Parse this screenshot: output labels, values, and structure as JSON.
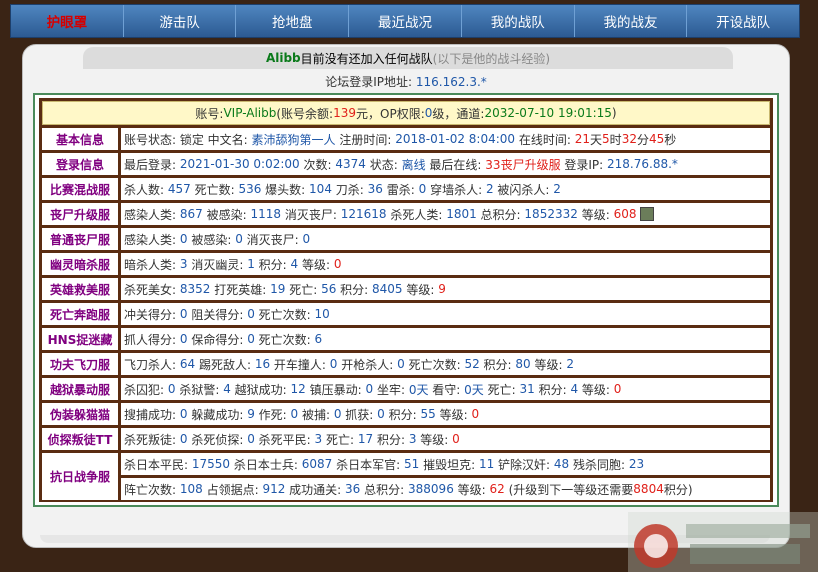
{
  "nav": [
    "护眼罩",
    "游击队",
    "抢地盘",
    "最近战况",
    "我的战队",
    "我的战友",
    "开设战队"
  ],
  "tabhead": {
    "name": "Alibb",
    "text": "目前没有还加入任何战队",
    "hint": "(以下是他的战斗经验)"
  },
  "ip": {
    "label": "论坛登录IP地址:",
    "value": "116.162.3.*"
  },
  "account": [
    {
      "t": "账号:",
      "c": "k"
    },
    {
      "t": "VIP-Alibb",
      "c": "g"
    },
    {
      "t": "(账号余额:",
      "c": "k"
    },
    {
      "t": "139",
      "c": "r"
    },
    {
      "t": "元，OP权限:",
      "c": "k"
    },
    {
      "t": "0",
      "c": "b"
    },
    {
      "t": "级，通道:",
      "c": "k"
    },
    {
      "t": "2032-07-10 19:01:15",
      "c": "g"
    },
    {
      "t": ")",
      "c": "k"
    }
  ],
  "rows": [
    {
      "label": "基本信息",
      "lines": [
        [
          {
            "t": "账号状态: 锁定 中文名: ",
            "c": "k"
          },
          {
            "t": "素沛舔狗第一人",
            "c": "b"
          },
          {
            "t": " 注册时间: ",
            "c": "k"
          },
          {
            "t": "2018-01-02 8:04:00",
            "c": "b"
          },
          {
            "t": " 在线时间: ",
            "c": "k"
          },
          {
            "t": "21",
            "c": "r"
          },
          {
            "t": "天",
            "c": "k"
          },
          {
            "t": "5",
            "c": "r"
          },
          {
            "t": "时",
            "c": "k"
          },
          {
            "t": "32",
            "c": "r"
          },
          {
            "t": "分",
            "c": "k"
          },
          {
            "t": "45",
            "c": "r"
          },
          {
            "t": "秒",
            "c": "k"
          }
        ]
      ]
    },
    {
      "label": "登录信息",
      "lines": [
        [
          {
            "t": "最后登录: ",
            "c": "k"
          },
          {
            "t": "2021-01-30 0:02:00",
            "c": "b"
          },
          {
            "t": " 次数: ",
            "c": "k"
          },
          {
            "t": "4374",
            "c": "b"
          },
          {
            "t": " 状态: ",
            "c": "k"
          },
          {
            "t": "离线",
            "c": "b"
          },
          {
            "t": " 最后在线: ",
            "c": "k"
          },
          {
            "t": "33丧尸升级服",
            "c": "r"
          },
          {
            "t": " 登录IP: ",
            "c": "k"
          },
          {
            "t": "218.76.88.*",
            "c": "b"
          }
        ]
      ]
    },
    {
      "label": "比赛混战服",
      "lines": [
        [
          {
            "t": "杀人数: ",
            "c": "k"
          },
          {
            "t": "457",
            "c": "b"
          },
          {
            "t": " 死亡数: ",
            "c": "k"
          },
          {
            "t": "536",
            "c": "b"
          },
          {
            "t": " 爆头数: ",
            "c": "k"
          },
          {
            "t": "104",
            "c": "b"
          },
          {
            "t": " 刀杀: ",
            "c": "k"
          },
          {
            "t": "36",
            "c": "b"
          },
          {
            "t": " 雷杀: ",
            "c": "k"
          },
          {
            "t": "0",
            "c": "b"
          },
          {
            "t": " 穿墙杀人: ",
            "c": "k"
          },
          {
            "t": "2",
            "c": "b"
          },
          {
            "t": " 被闪杀人: ",
            "c": "k"
          },
          {
            "t": "2",
            "c": "b"
          }
        ]
      ]
    },
    {
      "label": "丧尸升级服",
      "avatar": true,
      "lines": [
        [
          {
            "t": "感染人类: ",
            "c": "k"
          },
          {
            "t": "867",
            "c": "b"
          },
          {
            "t": " 被感染: ",
            "c": "k"
          },
          {
            "t": "1118",
            "c": "b"
          },
          {
            "t": " 消灭丧尸: ",
            "c": "k"
          },
          {
            "t": "121618",
            "c": "b"
          },
          {
            "t": " 杀死人类: ",
            "c": "k"
          },
          {
            "t": "1801",
            "c": "b"
          },
          {
            "t": " 总积分: ",
            "c": "k"
          },
          {
            "t": "1852332",
            "c": "b"
          },
          {
            "t": " 等级: ",
            "c": "k"
          },
          {
            "t": "608",
            "c": "r"
          }
        ]
      ]
    },
    {
      "label": "普通丧尸服",
      "lines": [
        [
          {
            "t": "感染人类: ",
            "c": "k"
          },
          {
            "t": "0",
            "c": "b"
          },
          {
            "t": " 被感染: ",
            "c": "k"
          },
          {
            "t": "0",
            "c": "b"
          },
          {
            "t": " 消灭丧尸: ",
            "c": "k"
          },
          {
            "t": "0",
            "c": "b"
          }
        ]
      ]
    },
    {
      "label": "幽灵暗杀服",
      "lines": [
        [
          {
            "t": "暗杀人类: ",
            "c": "k"
          },
          {
            "t": "3",
            "c": "b"
          },
          {
            "t": " 消灭幽灵: ",
            "c": "k"
          },
          {
            "t": "1",
            "c": "b"
          },
          {
            "t": " 积分: ",
            "c": "k"
          },
          {
            "t": "4",
            "c": "b"
          },
          {
            "t": " 等级: ",
            "c": "k"
          },
          {
            "t": "0",
            "c": "r"
          }
        ]
      ]
    },
    {
      "label": "英雄救美服",
      "lines": [
        [
          {
            "t": "杀死美女: ",
            "c": "k"
          },
          {
            "t": "8352",
            "c": "b"
          },
          {
            "t": " 打死英雄: ",
            "c": "k"
          },
          {
            "t": "19",
            "c": "b"
          },
          {
            "t": " 死亡: ",
            "c": "k"
          },
          {
            "t": "56",
            "c": "b"
          },
          {
            "t": " 积分: ",
            "c": "k"
          },
          {
            "t": "8405",
            "c": "b"
          },
          {
            "t": " 等级: ",
            "c": "k"
          },
          {
            "t": "9",
            "c": "r"
          }
        ]
      ]
    },
    {
      "label": "死亡奔跑服",
      "lines": [
        [
          {
            "t": "冲关得分: ",
            "c": "k"
          },
          {
            "t": "0",
            "c": "b"
          },
          {
            "t": " 阻关得分: ",
            "c": "k"
          },
          {
            "t": "0",
            "c": "b"
          },
          {
            "t": " 死亡次数: ",
            "c": "k"
          },
          {
            "t": "10",
            "c": "b"
          }
        ]
      ]
    },
    {
      "label": "HNS捉迷藏",
      "lines": [
        [
          {
            "t": "抓人得分: ",
            "c": "k"
          },
          {
            "t": "0",
            "c": "b"
          },
          {
            "t": " 保命得分: ",
            "c": "k"
          },
          {
            "t": "0",
            "c": "b"
          },
          {
            "t": " 死亡次数: ",
            "c": "k"
          },
          {
            "t": "6",
            "c": "b"
          }
        ]
      ]
    },
    {
      "label": "功夫飞刀服",
      "lines": [
        [
          {
            "t": "飞刀杀人: ",
            "c": "k"
          },
          {
            "t": "64",
            "c": "b"
          },
          {
            "t": " 踢死敌人: ",
            "c": "k"
          },
          {
            "t": "16",
            "c": "b"
          },
          {
            "t": " 开车撞人: ",
            "c": "k"
          },
          {
            "t": "0",
            "c": "b"
          },
          {
            "t": " 开枪杀人: ",
            "c": "k"
          },
          {
            "t": "0",
            "c": "b"
          },
          {
            "t": " 死亡次数: ",
            "c": "k"
          },
          {
            "t": "52",
            "c": "b"
          },
          {
            "t": " 积分: ",
            "c": "k"
          },
          {
            "t": "80",
            "c": "b"
          },
          {
            "t": " 等级: ",
            "c": "k"
          },
          {
            "t": "2",
            "c": "b"
          }
        ]
      ]
    },
    {
      "label": "越狱暴动服",
      "lines": [
        [
          {
            "t": "杀囚犯: ",
            "c": "k"
          },
          {
            "t": "0",
            "c": "b"
          },
          {
            "t": " 杀狱警: ",
            "c": "k"
          },
          {
            "t": "4",
            "c": "b"
          },
          {
            "t": " 越狱成功: ",
            "c": "k"
          },
          {
            "t": "12",
            "c": "b"
          },
          {
            "t": " 镇压暴动: ",
            "c": "k"
          },
          {
            "t": "0",
            "c": "b"
          },
          {
            "t": " 坐牢: ",
            "c": "k"
          },
          {
            "t": "0天",
            "c": "b"
          },
          {
            "t": " 看守: ",
            "c": "k"
          },
          {
            "t": "0天",
            "c": "b"
          },
          {
            "t": " 死亡: ",
            "c": "k"
          },
          {
            "t": "31",
            "c": "b"
          },
          {
            "t": " 积分: ",
            "c": "k"
          },
          {
            "t": "4",
            "c": "b"
          },
          {
            "t": " 等级: ",
            "c": "k"
          },
          {
            "t": "0",
            "c": "r"
          }
        ]
      ]
    },
    {
      "label": "伪装躲猫猫",
      "lines": [
        [
          {
            "t": "搜捕成功: ",
            "c": "k"
          },
          {
            "t": "0",
            "c": "b"
          },
          {
            "t": " 躲藏成功: ",
            "c": "k"
          },
          {
            "t": "9",
            "c": "b"
          },
          {
            "t": " 作死: ",
            "c": "k"
          },
          {
            "t": "0",
            "c": "b"
          },
          {
            "t": " 被捕: ",
            "c": "k"
          },
          {
            "t": "0",
            "c": "b"
          },
          {
            "t": " 抓获: ",
            "c": "k"
          },
          {
            "t": "0",
            "c": "b"
          },
          {
            "t": " 积分: ",
            "c": "k"
          },
          {
            "t": "55",
            "c": "b"
          },
          {
            "t": " 等级: ",
            "c": "k"
          },
          {
            "t": "0",
            "c": "r"
          }
        ]
      ]
    },
    {
      "label": "侦探叛徒TT",
      "lines": [
        [
          {
            "t": "杀死叛徒: ",
            "c": "k"
          },
          {
            "t": "0",
            "c": "b"
          },
          {
            "t": " 杀死侦探: ",
            "c": "k"
          },
          {
            "t": "0",
            "c": "b"
          },
          {
            "t": " 杀死平民: ",
            "c": "k"
          },
          {
            "t": "3",
            "c": "b"
          },
          {
            "t": " 死亡: ",
            "c": "k"
          },
          {
            "t": "17",
            "c": "b"
          },
          {
            "t": " 积分: ",
            "c": "k"
          },
          {
            "t": "3",
            "c": "b"
          },
          {
            "t": " 等级: ",
            "c": "k"
          },
          {
            "t": "0",
            "c": "r"
          }
        ]
      ]
    },
    {
      "label": "抗日战争服",
      "lines": [
        [
          {
            "t": "杀日本平民: ",
            "c": "k"
          },
          {
            "t": "17550",
            "c": "b"
          },
          {
            "t": " 杀日本士兵: ",
            "c": "k"
          },
          {
            "t": "6087",
            "c": "b"
          },
          {
            "t": " 杀日本军官: ",
            "c": "k"
          },
          {
            "t": "51",
            "c": "b"
          },
          {
            "t": " 摧毁坦克: ",
            "c": "k"
          },
          {
            "t": "11",
            "c": "b"
          },
          {
            "t": " 铲除汉奸: ",
            "c": "k"
          },
          {
            "t": "48",
            "c": "b"
          },
          {
            "t": " 残杀同胞: ",
            "c": "k"
          },
          {
            "t": "23",
            "c": "b"
          }
        ],
        [
          {
            "t": "阵亡次数: ",
            "c": "k"
          },
          {
            "t": "108",
            "c": "b"
          },
          {
            "t": " 占领据点: ",
            "c": "k"
          },
          {
            "t": "912",
            "c": "b"
          },
          {
            "t": " 成功通关: ",
            "c": "k"
          },
          {
            "t": "36",
            "c": "b"
          },
          {
            "t": " 总积分: ",
            "c": "k"
          },
          {
            "t": "388096",
            "c": "b"
          },
          {
            "t": " 等级: ",
            "c": "k"
          },
          {
            "t": "62",
            "c": "r"
          },
          {
            "t": " (升级到下一等级还需要",
            "c": "k"
          },
          {
            "t": "8804",
            "c": "r"
          },
          {
            "t": "积分)",
            "c": "k"
          }
        ]
      ]
    }
  ],
  "colors": {
    "nav_bg": "#3c6fa8",
    "label": "#800080",
    "blue": "#1f57a8",
    "red": "#e0201a",
    "green": "#0a7a1a",
    "board_border": "#4a8a5a",
    "inner_bg": "#5a2c12",
    "account_bg": "#fff8c8"
  }
}
